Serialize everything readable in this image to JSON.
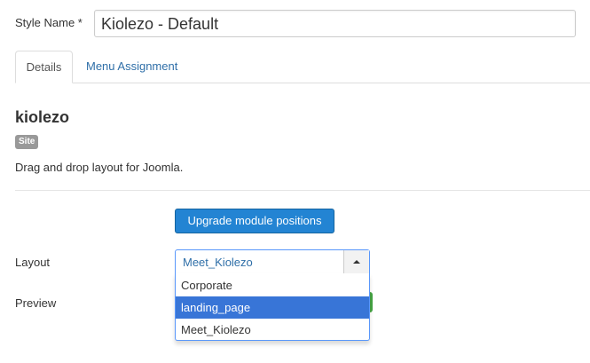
{
  "style": {
    "label": "Style Name *",
    "value": "Kiolezo - Default"
  },
  "tabs": [
    {
      "label": "Details",
      "active": true
    },
    {
      "label": "Menu Assignment",
      "active": false
    }
  ],
  "extension": {
    "title": "kiolezo",
    "badge": "Site",
    "description": "Drag and drop layout for Joomla."
  },
  "upgrade_button": {
    "label": "Upgrade module positions"
  },
  "layout": {
    "label": "Layout",
    "selected": "Meet_Kiolezo",
    "options": [
      "Corporate",
      "landing_page",
      "Meet_Kiolezo"
    ],
    "highlighted": "landing_page"
  },
  "preview": {
    "label": "Preview"
  },
  "colors": {
    "primary_button": "#2384d3",
    "link": "#2f6fa8",
    "highlight": "#3875d7",
    "badge": "#999999",
    "success": "#46a546"
  }
}
